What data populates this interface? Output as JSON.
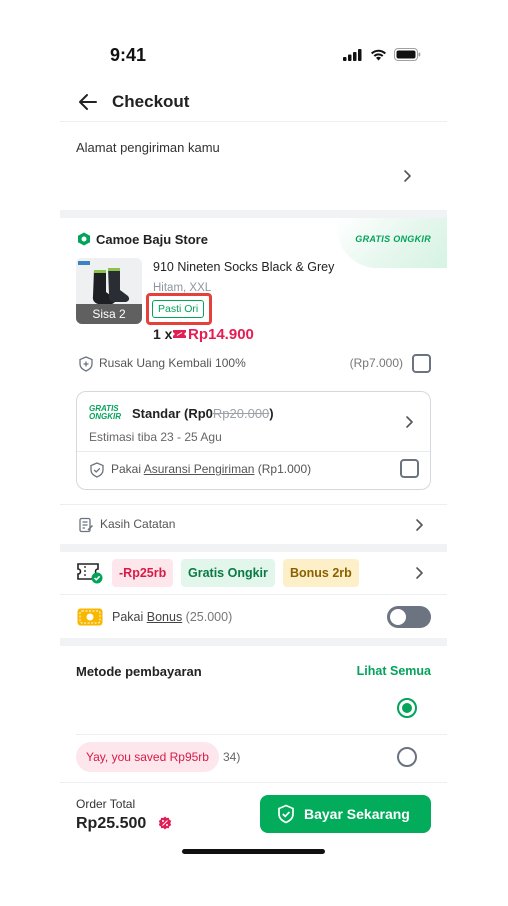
{
  "status": {
    "time": "9:41"
  },
  "header": {
    "title": "Checkout"
  },
  "address": {
    "label": "Alamat pengiriman kamu"
  },
  "store": {
    "name": "Camoe Baju Store",
    "gratis_ongkir_tag": "GRATIS ONGKIR",
    "product": {
      "name": "910 Nineten Socks Black & Grey",
      "variant": "Hitam, XXL",
      "stock_label": "Sisa 2",
      "badge": "Pasti Ori",
      "qty": "1 x",
      "price": "Rp14.900"
    },
    "protection": {
      "label": "Rusak Uang Kembali 100%",
      "fee": "(Rp7.000)"
    },
    "shipping": {
      "gratis_line1": "GRATIS",
      "gratis_line2": "ONGKIR",
      "service": "Standar (Rp0",
      "old_price": "Rp20.000",
      "close": ")",
      "eta": "Estimasi tiba 23 - 25 Agu",
      "insurance_prefix": "Pakai ",
      "insurance_link": "Asuransi Pengiriman",
      "insurance_fee": " (Rp1.000)"
    },
    "note": "Kasih Catatan"
  },
  "promo": {
    "chips": [
      "-Rp25rb",
      "Gratis Ongkir",
      "Bonus 2rb"
    ]
  },
  "bonus": {
    "prefix": "Pakai ",
    "link": "Bonus",
    "amount": " (25.000)",
    "enabled": false
  },
  "payment": {
    "heading": "Metode pembayaran",
    "see_all": "Lihat Semua",
    "saved_bubble": "Yay, you saved Rp95rb",
    "partial_text": "34)"
  },
  "footer": {
    "total_label": "Order Total",
    "total_value": "Rp25.500",
    "pay_button": "Bayar Sekarang"
  },
  "colors": {
    "accent_green": "#03ac5b",
    "price_red": "#e21e54",
    "highlight_red": "#e5413b"
  }
}
